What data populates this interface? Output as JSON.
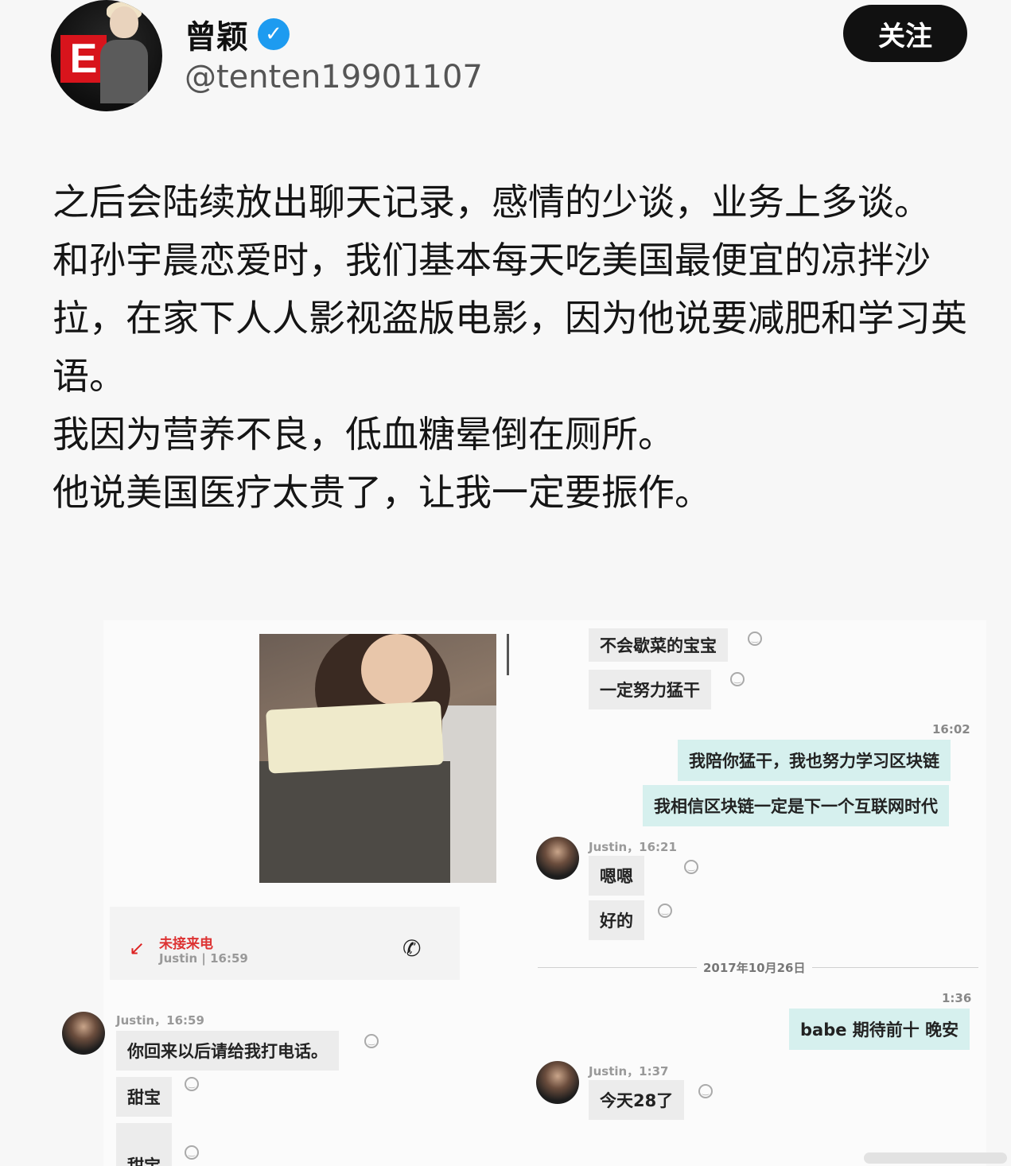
{
  "profile": {
    "name": "曾颖",
    "handle": "@tenten19901107",
    "follow_label": "关注",
    "verified_icon": "verified-badge-icon",
    "avatar_logo_text": "E"
  },
  "post": {
    "lines": [
      "之后会陆续放出聊天记录，感情的少谈，业务上多谈。",
      "和孙宇晨恋爱时，我们基本每天吃美国最便宜的凉拌沙拉，在家下人人影视盗版电影，因为他说要减肥和学习英语。",
      "我因为营养不良，低血糖晕倒在厕所。",
      "他说美国医疗太贵了，让我一定要振作。"
    ]
  },
  "chat_right": {
    "msg1": "不会歇菜的宝宝",
    "msg2": "一定努力猛干",
    "time1": "16:02",
    "msg3": "我陪你猛干，我也努力学习区块链",
    "msg4": "我相信区块链一定是下一个互联网时代",
    "meta1": "Justin，16:21",
    "msg5": "嗯嗯",
    "msg6": "好的",
    "date_sep": "2017年10月26日",
    "time2": "1:36",
    "msg7": "babe 期待前十 晚安",
    "meta2": "Justin，1:37",
    "msg8": "今天28了"
  },
  "chat_left": {
    "missed_title": "未接来电",
    "missed_sub": "Justin | 16:59",
    "meta1": "Justin，16:59",
    "msg1": "你回来以后请给我打电话。",
    "msg2": "甜宝",
    "msg3": "甜宝"
  },
  "colors": {
    "follow_bg": "#111111",
    "verified": "#1d9bf0",
    "teal_bubble": "#d6f0ee",
    "missed_red": "#dd2222"
  }
}
